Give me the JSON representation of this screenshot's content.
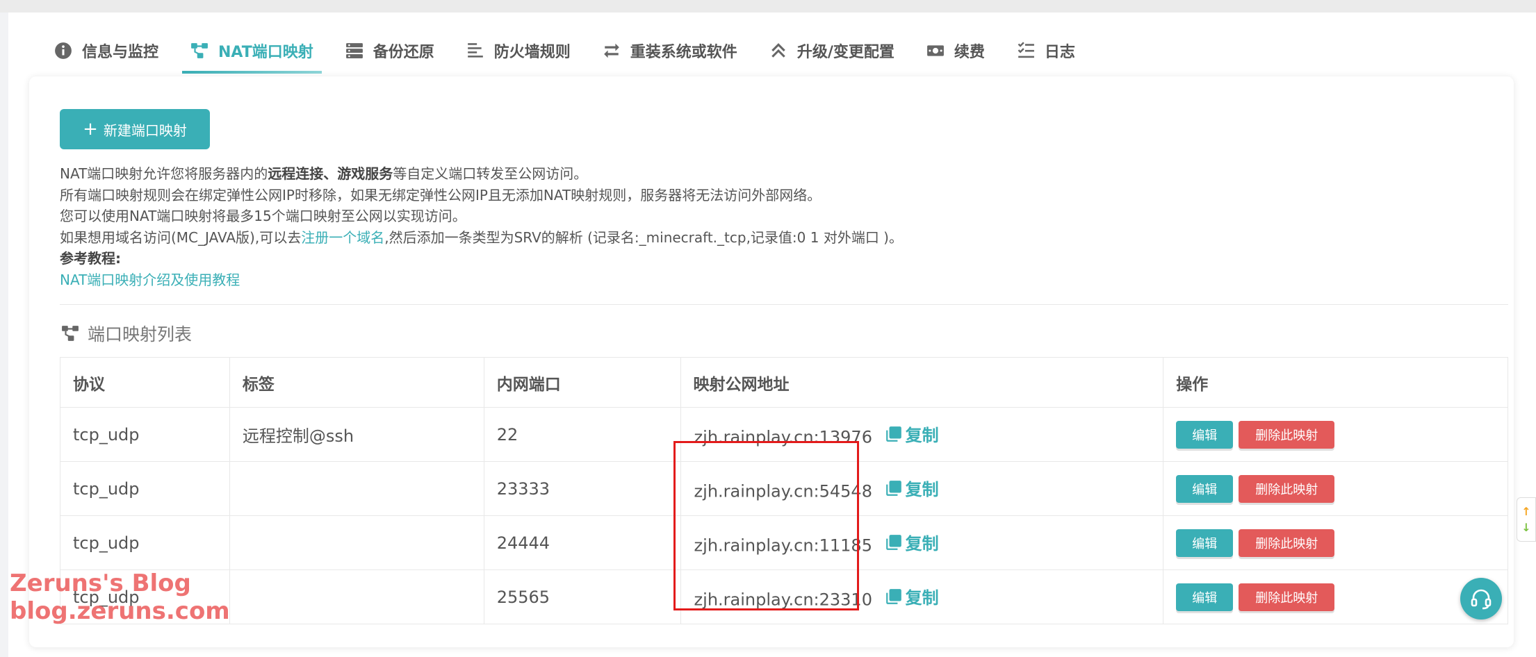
{
  "tabs": [
    {
      "label": "信息与监控",
      "icon": "info-icon",
      "active": false
    },
    {
      "label": "NAT端口映射",
      "icon": "network-icon",
      "active": true
    },
    {
      "label": "备份还原",
      "icon": "server-icon",
      "active": false
    },
    {
      "label": "防火墙规则",
      "icon": "list-icon",
      "active": false
    },
    {
      "label": "重装系统或软件",
      "icon": "swap-icon",
      "active": false
    },
    {
      "label": "升级/变更配置",
      "icon": "chevron-up-icon",
      "active": false
    },
    {
      "label": "续费",
      "icon": "money-icon",
      "active": false
    },
    {
      "label": "日志",
      "icon": "checklist-icon",
      "active": false
    }
  ],
  "new_button": {
    "label": "新建端口映射"
  },
  "description": {
    "line1_a": "NAT端口映射允许您将服务器内的",
    "line1_b": "远程连接、游戏服务",
    "line1_c": "等自定义端口转发至公网访问。",
    "line2": "所有端口映射规则会在绑定弹性公网IP时移除，如果无绑定弹性公网IP且无添加NAT映射规则，服务器将无法访问外部网络。",
    "line3": "您可以使用NAT端口映射将最多15个端口映射至公网以实现访问。",
    "line4_a": "如果想用域名访问(MC_JAVA版),可以去",
    "line4_link": "注册一个域名",
    "line4_b": ",然后添加一条类型为SRV的解析 (记录名:_minecraft._tcp,记录值:0 1 对外端口 )。",
    "ref_title": "参考教程:",
    "ref_link": "NAT端口映射介绍及使用教程"
  },
  "section_title": "端口映射列表",
  "table": {
    "headers": [
      "协议",
      "标签",
      "内网端口",
      "映射公网地址",
      "操作"
    ],
    "rows": [
      {
        "protocol": "tcp_udp",
        "tag": "远程控制@ssh",
        "port": "22",
        "address": "zjh.rainplay.cn:13976"
      },
      {
        "protocol": "tcp_udp",
        "tag": "",
        "port": "23333",
        "address": "zjh.rainplay.cn:54548"
      },
      {
        "protocol": "tcp_udp",
        "tag": "",
        "port": "24444",
        "address": "zjh.rainplay.cn:11185"
      },
      {
        "protocol": "tcp_udp",
        "tag": "",
        "port": "25565",
        "address": "zjh.rainplay.cn:23310"
      }
    ],
    "copy_label": "复制",
    "edit_label": "编辑",
    "delete_label": "删除此映射"
  },
  "watermark": {
    "line1": "Zeruns's Blog",
    "line2": "blog.zeruns.com"
  },
  "scroll_widget": {
    "up": "↑",
    "down": "↓"
  },
  "colors": {
    "accent": "#3aafb6",
    "danger": "#e35a5a",
    "highlight": "#e31b1b"
  }
}
